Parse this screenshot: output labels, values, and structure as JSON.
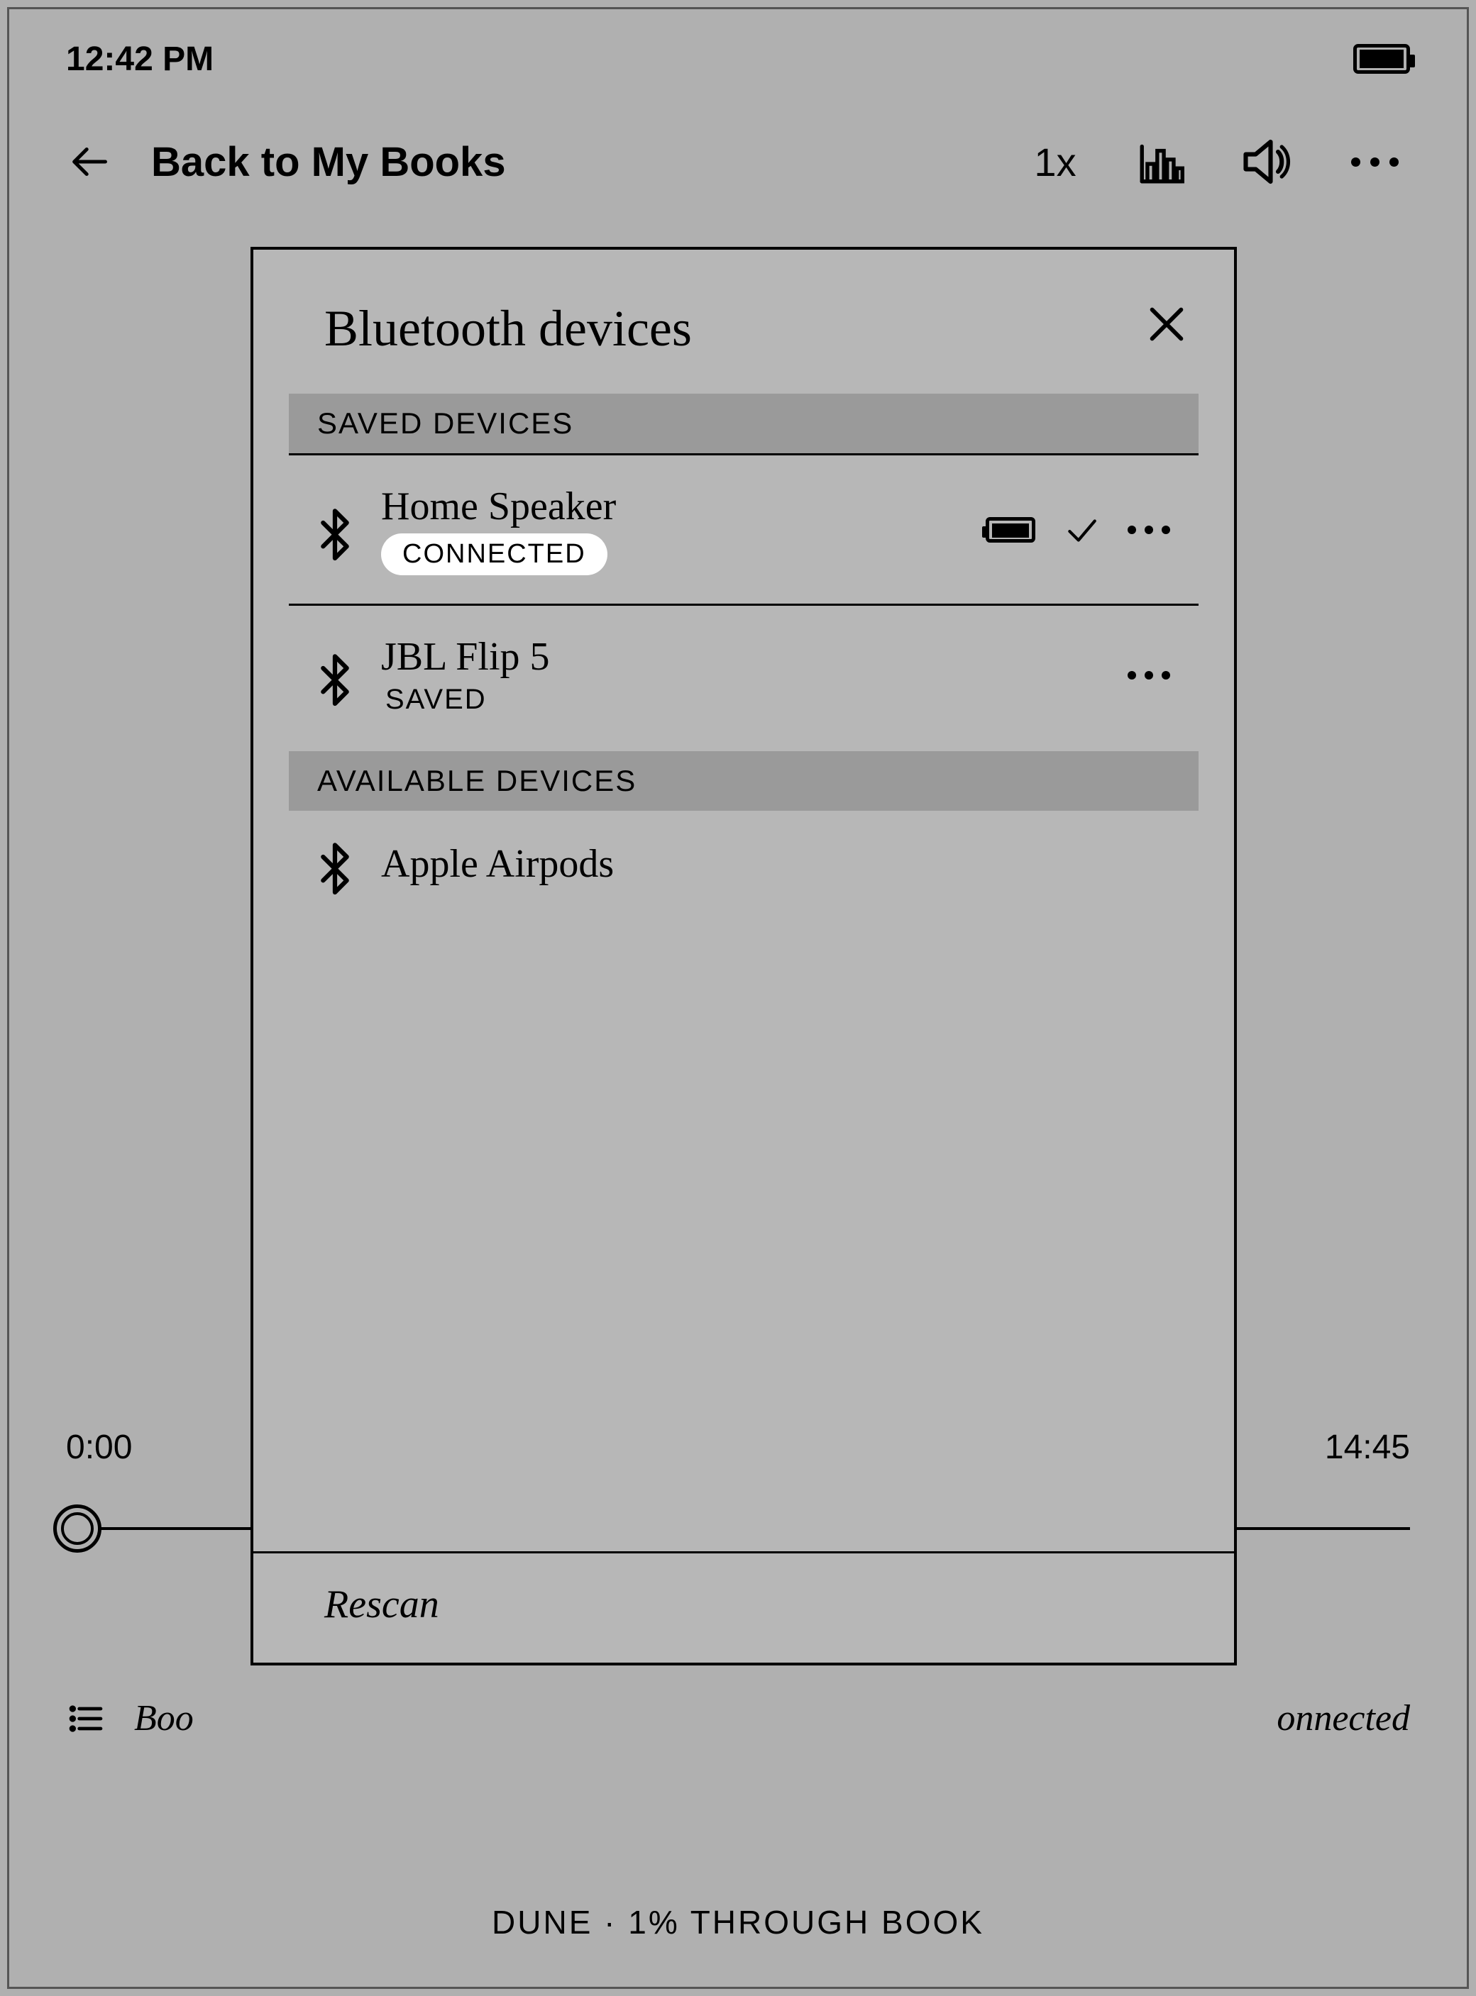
{
  "status": {
    "time": "12:42 PM"
  },
  "nav": {
    "back_label": "Back to My Books",
    "speed": "1x"
  },
  "player": {
    "elapsed": "0:00",
    "remaining": "14:45",
    "book_label_left": "Boo",
    "right_partial": "onnected",
    "footer": "DUNE · 1% THROUGH BOOK"
  },
  "dialog": {
    "title": "Bluetooth devices",
    "saved_header": "SAVED DEVICES",
    "available_header": "AVAILABLE DEVICES",
    "saved": [
      {
        "name": "Home Speaker",
        "status": "CONNECTED",
        "connected": true
      },
      {
        "name": "JBL Flip 5",
        "status": "SAVED",
        "connected": false
      }
    ],
    "available": [
      {
        "name": "Apple Airpods"
      }
    ],
    "rescan": "Rescan"
  }
}
